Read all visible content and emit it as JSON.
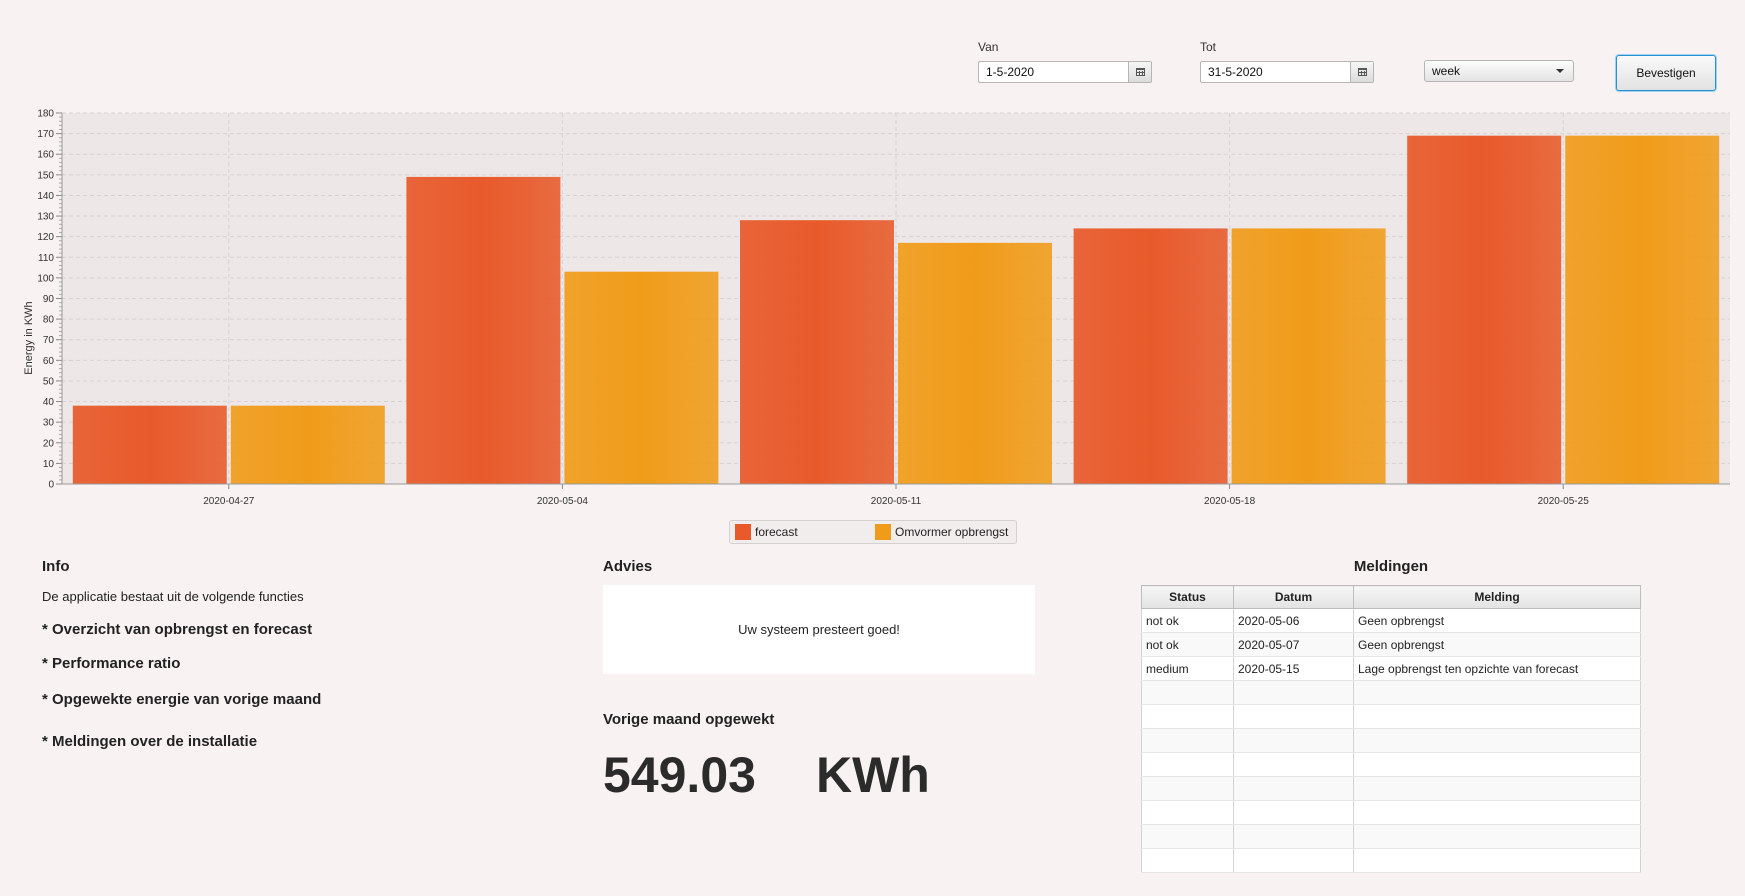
{
  "controls": {
    "from_label": "Van",
    "from_value": "1-5-2020",
    "to_label": "Tot",
    "to_value": "31-5-2020",
    "period_value": "week",
    "confirm_label": "Bevestigen"
  },
  "chart_data": {
    "type": "bar",
    "categories": [
      "2020-04-27",
      "2020-05-04",
      "2020-05-11",
      "2020-05-18",
      "2020-05-25"
    ],
    "series": [
      {
        "name": "forecast",
        "values": [
          38,
          149,
          128,
          124,
          169
        ],
        "color": "#e85a2a"
      },
      {
        "name": "Omvormer opbrengst",
        "values": [
          38,
          103,
          117,
          124,
          169
        ],
        "color": "#f09c1a"
      }
    ],
    "ylabel": "Energy in KWh",
    "xlabel": "",
    "ylim": [
      0,
      180
    ],
    "yticks": [
      0,
      10,
      20,
      30,
      40,
      50,
      60,
      70,
      80,
      90,
      100,
      110,
      120,
      130,
      140,
      150,
      160,
      170,
      180
    ],
    "grid": true,
    "legend_position": "bottom"
  },
  "info": {
    "title": "Info",
    "intro": "De applicatie bestaat uit de volgende functies",
    "features": [
      "* Overzicht van opbrengst en forecast",
      "* Performance ratio",
      "* Opgewekte energie van vorige maand",
      "* Meldingen over de installatie"
    ]
  },
  "advice": {
    "title": "Advies",
    "text": "Uw systeem presteert goed!"
  },
  "last_month": {
    "title": "Vorige maand opgewekt",
    "value": "549.03",
    "unit": "KWh"
  },
  "notifications": {
    "title": "Meldingen",
    "columns": [
      "Status",
      "Datum",
      "Melding"
    ],
    "rows": [
      [
        "not ok",
        "2020-05-06",
        "Geen opbrengst"
      ],
      [
        "not ok",
        "2020-05-07",
        "Geen opbrengst"
      ],
      [
        "medium",
        "2020-05-15",
        "Lage opbrengst ten opzichte van forecast"
      ]
    ]
  }
}
